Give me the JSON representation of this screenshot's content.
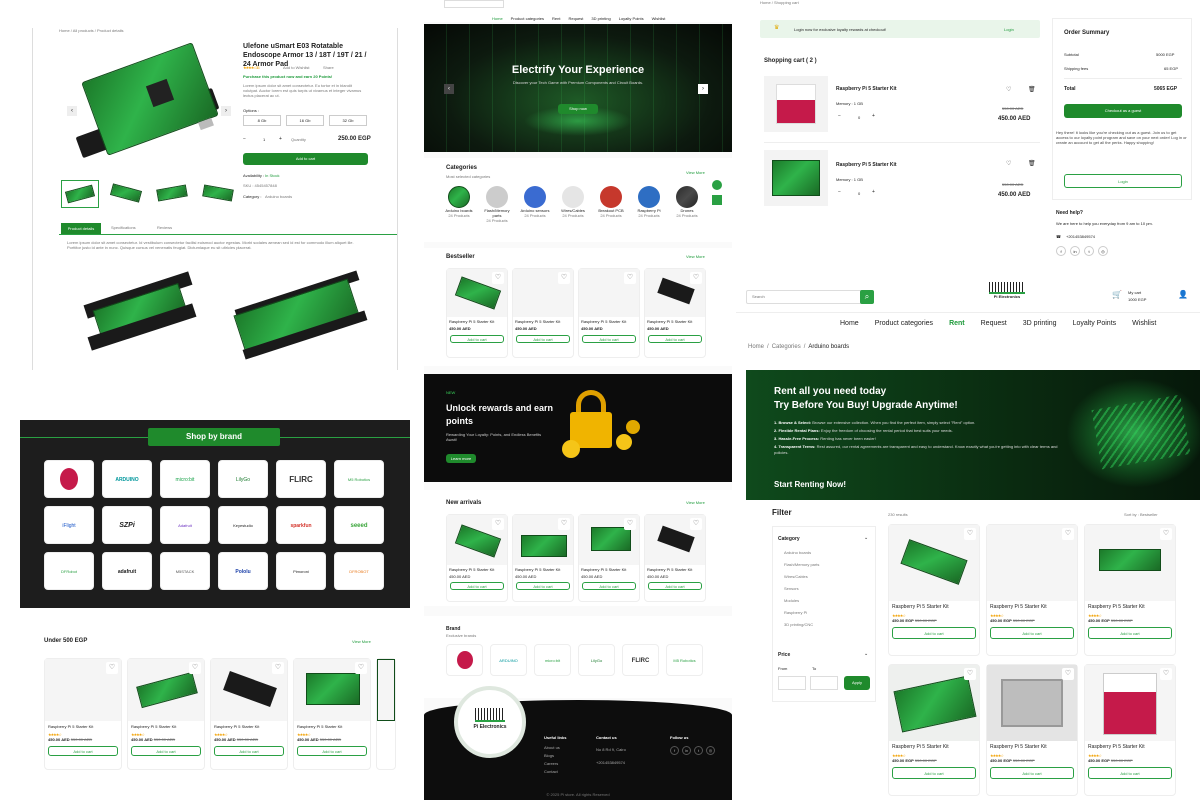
{
  "product": {
    "breadcrumb": "Home / All products / Product details",
    "title": "Ulefone uSmart E03 Rotatable Endoscope Armor 13 / 18T / 19T / 21 / 24 Armor Pad",
    "rating_text": "★★★★☆ 3.5",
    "wishlist": "Add to Wishlist",
    "share": "Share",
    "points_text": "Purchase this product now and earn 20 Points!",
    "desc": "Lorem ipsum dolor sit amet consectetur. Eu tortor et in blandit volutpat. Auctor lorem est quis turpis ut vivamus et integer vivamus lectus placerat ac ut.",
    "options_label": "Options :",
    "options": [
      "8 Gb",
      "16 Gb",
      "32 Gb"
    ],
    "qty": "1",
    "qty_label": "Quantity",
    "price": "250.00 EGP",
    "add_to_cart": "Add to cart",
    "availability_label": "Availability :",
    "availability": "In Stock",
    "sku": "SKU : 4545457848",
    "category_label": "Category :",
    "category": "Arduino boards",
    "tabs": [
      "Product details",
      "Specifications",
      "Reviews"
    ],
    "tab_text": "Lorem ipsum dolor sit amet consectetur. Id vestibulum consectetur facilisi euismod auctor egestas. Morbi sodales aenean sed id est for commodo illum aliquet ille. Porttitor justo id ante in nunc. Quisque cursus vel venenatis feugiat. Dictumlaque eu sit ultricies placerat."
  },
  "home": {
    "nav": [
      "Home",
      "Product categories",
      "Rent",
      "Request",
      "3D printing",
      "Loyalty Points",
      "Wishlist"
    ],
    "hero_title": "Electrify Your Experience",
    "hero_sub": "Discover your Tech Game with Premium Components and Circuit Boards.",
    "hero_btn": "Shop now",
    "categories_title": "Categories",
    "categories_sub": "Most selected categories",
    "view_more": "View More",
    "categories": [
      {
        "name": "Arduino boards",
        "count": "24 Products"
      },
      {
        "name": "Flash/Memory parts",
        "count": "24 Products"
      },
      {
        "name": "Arduino sensors",
        "count": "24 Products"
      },
      {
        "name": "Wires/Cables",
        "count": "24 Products"
      },
      {
        "name": "Breakout PCB",
        "count": "24 Products"
      },
      {
        "name": "Raspberry Pi",
        "count": "24 Products"
      },
      {
        "name": "Drones",
        "count": "24 Products"
      }
    ],
    "bestseller_title": "Bestseller",
    "bestsellers": [
      {
        "name": "Raspberry Pi 5 Starter Kit",
        "price": "450.00 AED"
      },
      {
        "name": "Raspberry Pi 5 Starter Kit",
        "price": "450.00 AED"
      },
      {
        "name": "Raspberry Pi 5 Starter Kit",
        "price": "450.00 AED"
      },
      {
        "name": "Raspberry Pi 5 Starter Kit",
        "price": "450.00 AED"
      }
    ],
    "add_to_cart": "Add to cart",
    "rewards_tag": "NEW",
    "rewards_title": "Unlock rewards and earn points",
    "rewards_sub": "Rewarding Your Loyalty: Points, and Endless Benefits Await!",
    "rewards_btn": "Learn more",
    "new_arrivals_title": "New arrivals",
    "new_arrivals": [
      {
        "name": "Raspberry Pi 5 Starter Kit",
        "price": "450.00 AED"
      },
      {
        "name": "Raspberry Pi 5 Starter Kit",
        "price": "450.00 AED"
      },
      {
        "name": "Raspberry Pi 5 Starter Kit",
        "price": "450.00 AED"
      },
      {
        "name": "Raspberry Pi 5 Starter Kit",
        "price": "450.00 AED"
      }
    ],
    "brand_title": "Brand",
    "brand_sub": "Exclusive brands",
    "brands": [
      "raspberry",
      "ARDUINO",
      "micro:bit",
      "LilyGo",
      "FLIRC",
      "M5 Robotics"
    ],
    "footer": {
      "logo": "Pi Electronics",
      "col1_title": "Useful links",
      "col1": [
        "About us",
        "Blogs",
        "Careers",
        "Contact"
      ],
      "col2_title": "Contact us",
      "col2": [
        "No 8 Rd 9, Cairo",
        "+201453849574"
      ],
      "col3_title": "Follow us",
      "copyright": "© 2025 Pi store. All rights Reserved"
    }
  },
  "cart": {
    "breadcrumb": "Home / Shopping cart",
    "loyalty_msg": "Login now for exclusive loyalty rewards at checkout!",
    "login": "Login",
    "title": "Shopping cart ( 2 )",
    "items": [
      {
        "name": "Raspberry Pi 5 Starter Kit",
        "memory": "Memory : 1 GB",
        "qty": "0",
        "old_price": "550.00 AED",
        "price": "450.00 AED"
      },
      {
        "name": "Raspberry Pi 5 Starter Kit",
        "memory": "Memory : 1 GB",
        "qty": "0",
        "old_price": "550.00 AED",
        "price": "450.00 AED"
      }
    ],
    "summary_title": "Order Summary",
    "subtotal_label": "Subtotal",
    "subtotal": "5000 EGP",
    "shipping_label": "Shipping fees",
    "shipping": "65 EGP",
    "total_label": "Total",
    "total": "5065 EGP",
    "checkout": "Checkout as a guest",
    "guest_msg": "Hey there! It looks like you're checking out as a guest. Join us to get access to our loyalty point program and save on your next order! Log in or create an account to get all the perks. Happy shopping!",
    "login_btn": "Login",
    "help_title": "Need help?",
    "help_text": "We are here to help you everyday from 9 am to 10 pm.",
    "phone": "+201453849574"
  },
  "rent": {
    "search_placeholder": "Search",
    "logo": "Pi Electronics",
    "cart_label": "My cart",
    "cart_amount": "1000 EGP",
    "nav": [
      "Home",
      "Product categories",
      "Rent",
      "Request",
      "3D printing",
      "Loyalty Points",
      "Wishlist"
    ],
    "breadcrumb": [
      "Home",
      "Categories",
      "Arduino boards"
    ],
    "banner_title_1": "Rent all you need today",
    "banner_title_2": "Try Before You Buy! Upgrade Anytime!",
    "steps": [
      {
        "bold": "1. Browse & Select:",
        "text": "Browse our extensive collection. When you find the perfect item, simply select \"Rent\" option."
      },
      {
        "bold": "2. Flexible Rental Plans:",
        "text": "Enjoy the freedom of choosing the rental period that best suits your needs."
      },
      {
        "bold": "3. Hassle-Free Process:",
        "text": "Renting has never been easier!"
      },
      {
        "bold": "4. Transparent Terms:",
        "text": "Rest assured, our rental agreements are transparent and easy to understand. Know exactly what you're getting into with clear terms and policies."
      }
    ],
    "banner_cta": "Start Renting Now!",
    "filter_title": "Filter",
    "results": "230 results",
    "sort": "Sort by : Bestseller",
    "filter_category": "Category",
    "filter_items": [
      "Arduino boards",
      "Flash/Memory parts",
      "Wires/Cables",
      "Sensors",
      "Modules",
      "Raspberry Pi",
      "3D printing/CNC"
    ],
    "filter_price": "Price",
    "from_label": "From",
    "to_label": "To",
    "apply": "Apply",
    "products": [
      {
        "name": "Raspberry Pi 5 Starter Kit",
        "price": "450.00 EGP",
        "old": "550.00 EGP"
      },
      {
        "name": "Raspberry Pi 5 Starter Kit",
        "price": "450.00 EGP",
        "old": "550.00 EGP"
      },
      {
        "name": "Raspberry Pi 5 Starter Kit",
        "price": "450.00 EGP",
        "old": "550.00 EGP"
      },
      {
        "name": "Raspberry Pi 5 Starter Kit",
        "price": "450.00 EGP",
        "old": "550.00 EGP"
      },
      {
        "name": "Raspberry Pi 5 Starter Kit",
        "price": "450.00 EGP",
        "old": "550.00 EGP"
      },
      {
        "name": "Raspberry Pi 5 Starter Kit",
        "price": "450.00 EGP",
        "old": "550.00 EGP"
      }
    ],
    "add_to_cart": "Add to cart"
  },
  "brands_panel": {
    "title": "Shop by brand",
    "brands": [
      "raspberry",
      "ARDUINO",
      "micro:bit",
      "LilyGo",
      "FLIRC",
      "M5 Robotics",
      "iFlight",
      "SZPi",
      "Adafruit",
      "Keyestudio",
      "sparkfun",
      "seeed",
      "DFRobot",
      "adafruit",
      "M5STACK",
      "Pololu",
      "Pimoroni",
      "DFROBOT"
    ]
  },
  "under500": {
    "title": "Under 500 EGP",
    "view_more": "View More",
    "products": [
      {
        "name": "Raspberry Pi 5 Starter Kit",
        "price": "450.00 AED",
        "old": "550.00 AED"
      },
      {
        "name": "Raspberry Pi 5 Starter Kit",
        "price": "450.00 AED",
        "old": "550.00 AED"
      },
      {
        "name": "Raspberry Pi 5 Starter Kit",
        "price": "450.00 AED",
        "old": "550.00 AED"
      },
      {
        "name": "Raspberry Pi 5 Starter Kit",
        "price": "450.00 AED",
        "old": "550.00 AED"
      }
    ],
    "add_to_cart": "Add to cart"
  },
  "colors": {
    "accent": "#1f8a2c",
    "dark": "#1b1b1b",
    "star": "#f2a100"
  }
}
